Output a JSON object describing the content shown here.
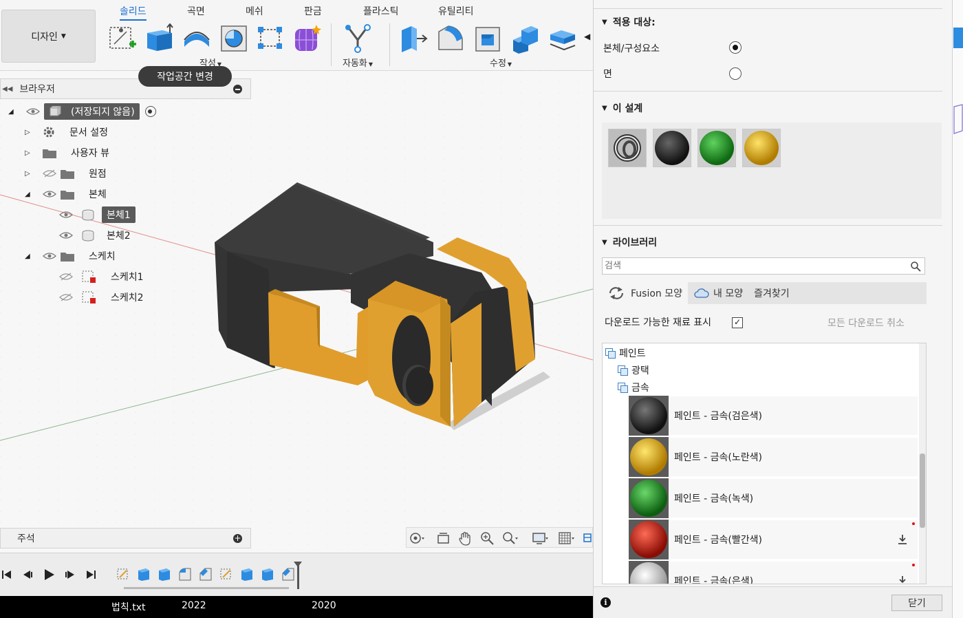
{
  "toolbar": {
    "design_label": "디자인",
    "tabs": [
      "솔리드",
      "곡면",
      "메쉬",
      "판금",
      "플라스틱",
      "유틸리티"
    ],
    "active_tab": "솔리드",
    "groups": {
      "create": "작성",
      "automate": "자동화",
      "modify": "수정"
    },
    "tooltip": "작업공간 변경"
  },
  "browser": {
    "title": "브라우저",
    "root": "(저장되지 않음)",
    "items": [
      {
        "label": "문서 설정",
        "icon": "gear-icon"
      },
      {
        "label": "사용자 뷰",
        "icon": "folder-icon"
      },
      {
        "label": "원점",
        "icon": "folder-icon"
      },
      {
        "label": "본체",
        "icon": "folder-icon"
      },
      {
        "label": "본체1",
        "icon": "body-icon"
      },
      {
        "label": "본체2",
        "icon": "body-icon"
      },
      {
        "label": "스케치",
        "icon": "folder-icon"
      },
      {
        "label": "스케치1",
        "icon": "sketch-icon"
      },
      {
        "label": "스케치2",
        "icon": "sketch-icon"
      }
    ]
  },
  "comments": {
    "title": "주석"
  },
  "taskbar": {
    "items": [
      "법칙.txt",
      "2022",
      "2020"
    ]
  },
  "appearance": {
    "apply_to": {
      "title": "적용 대상:",
      "options": [
        "본체/구성요소",
        "면"
      ],
      "selected": "본체/구성요소"
    },
    "in_design": {
      "title": "이 설계"
    },
    "library": {
      "title": "라이브러리",
      "search_placeholder": "검색",
      "tabs": [
        "Fusion 모양",
        "내 모양",
        "즐겨찾기"
      ],
      "show_downloadable": "다운로드 가능한 재료 표시",
      "cancel_downloads": "모든 다운로드 취소",
      "tree": {
        "root": "페인트",
        "child1": "광택",
        "child2": "금속"
      },
      "materials": [
        {
          "name": "페인트 - 금속(검은색)",
          "color": "#1e1e1e"
        },
        {
          "name": "페인트 - 금속(노란색)",
          "color": "#e2b00a"
        },
        {
          "name": "페인트 - 금속(녹색)",
          "color": "#1f8f22"
        },
        {
          "name": "페인트 - 금속(빨간색)",
          "color": "#c81a0e"
        },
        {
          "name": "페인트 - 금속(은색)",
          "color": "#e6e6e6"
        }
      ]
    },
    "close_label": "닫기"
  },
  "colors": {
    "accent": "#1a6fd0",
    "body_dark": "#3a3a3a",
    "body_yellow": "#e0a030"
  }
}
